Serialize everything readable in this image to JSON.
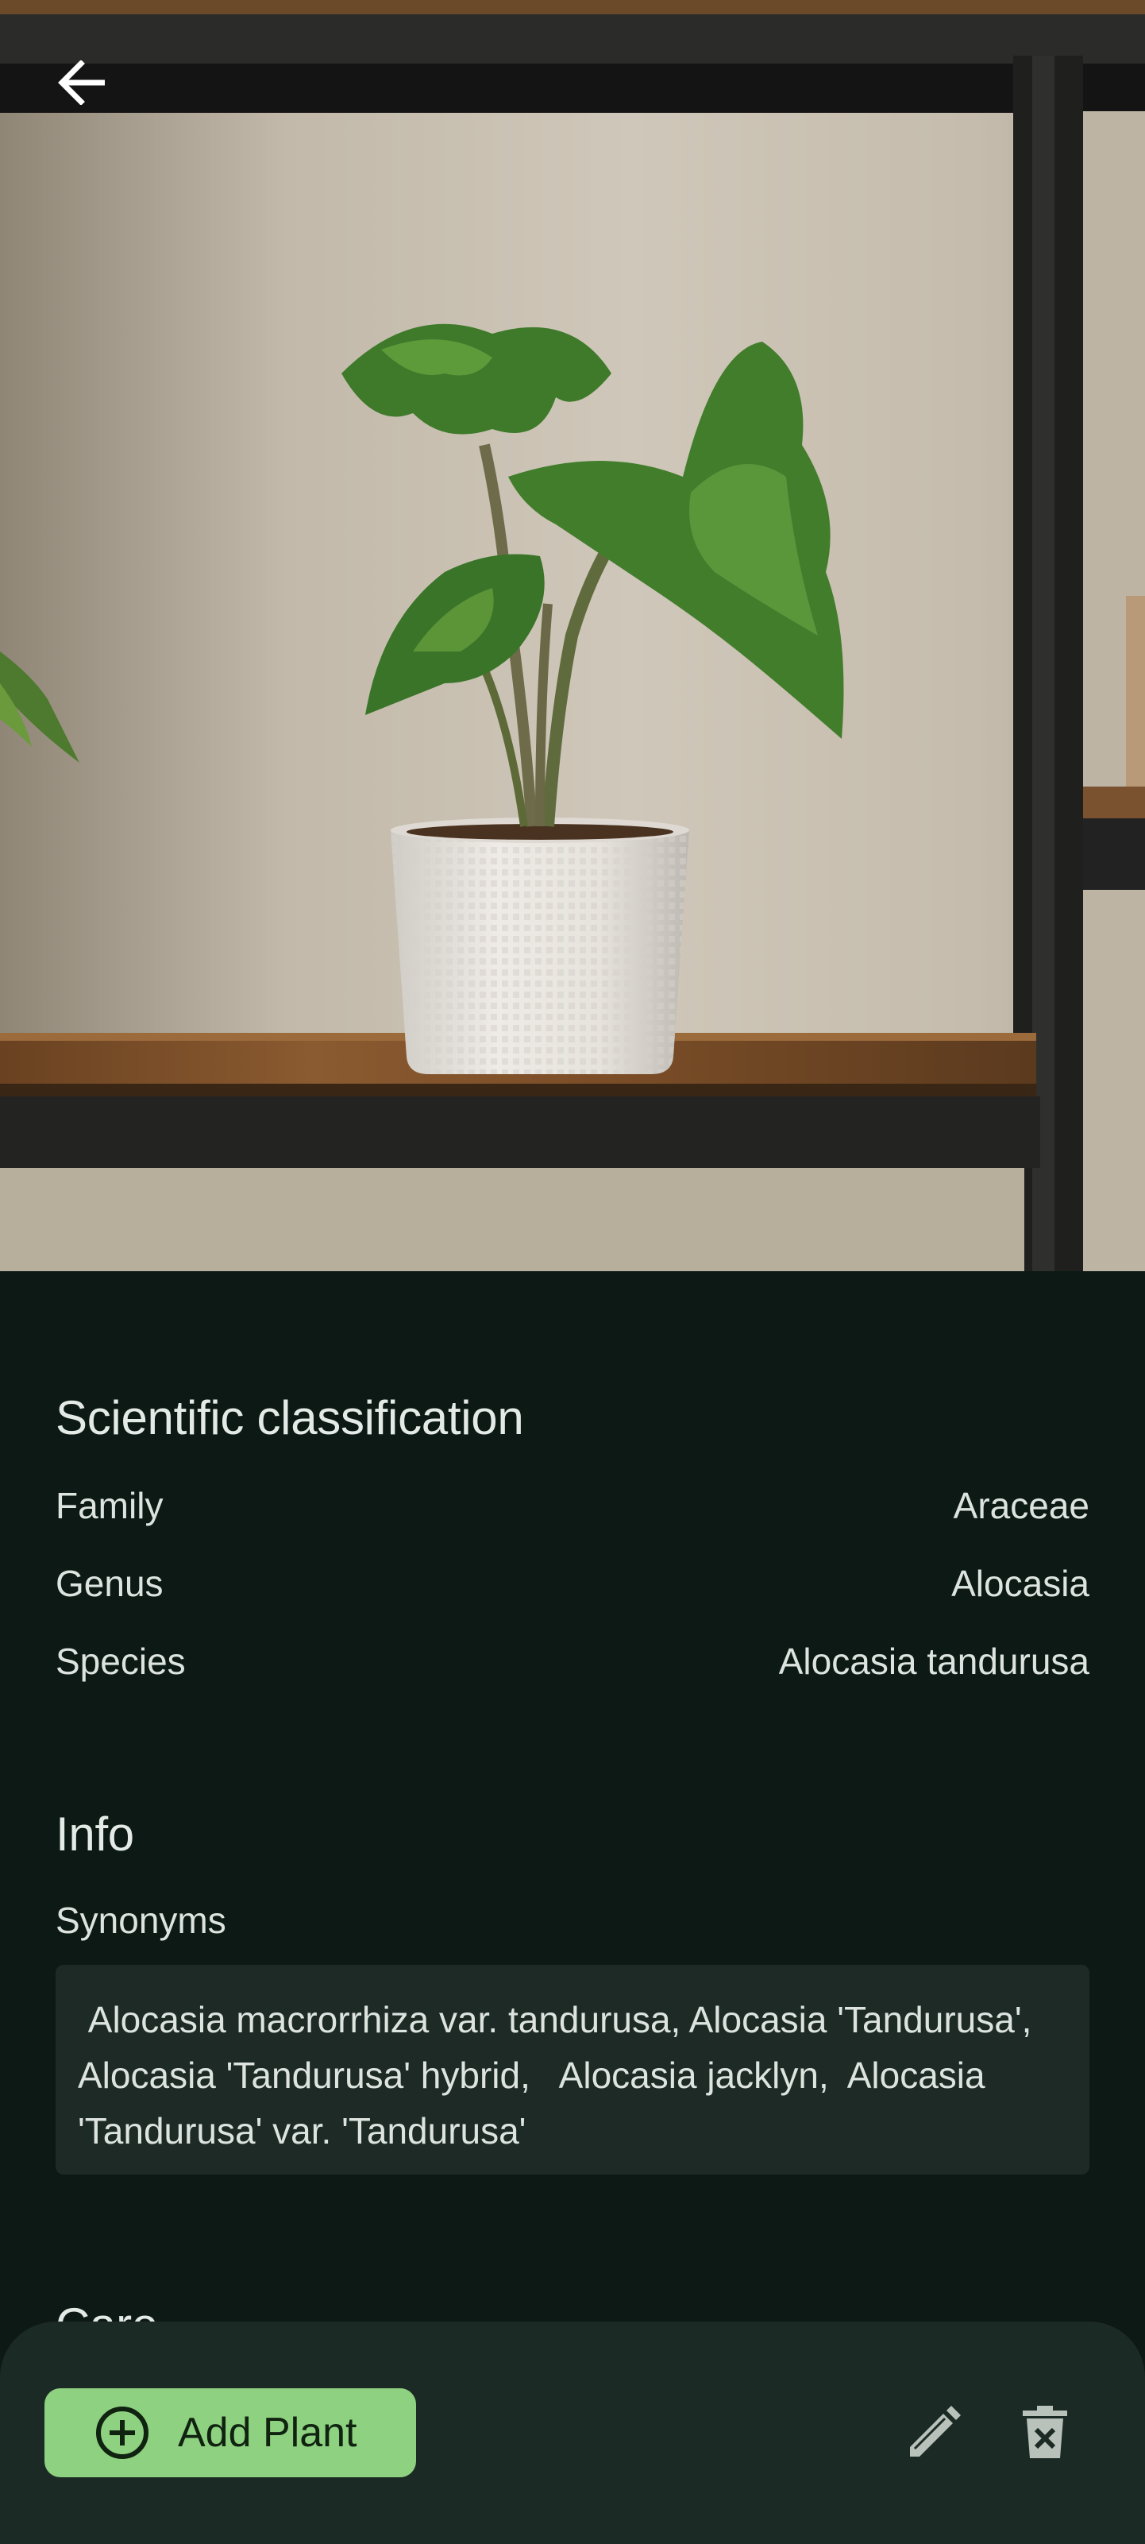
{
  "hero": {
    "image": "photo of a potted Alocasia plant on a wooden shelf",
    "back_icon": "arrow-left-icon"
  },
  "classification": {
    "title": "Scientific classification",
    "rows": [
      {
        "label": "Family",
        "value": "Araceae"
      },
      {
        "label": "Genus",
        "value": "Alocasia"
      },
      {
        "label": "Species",
        "value": "Alocasia tandurusa"
      }
    ]
  },
  "info": {
    "title": "Info",
    "synonyms_label": "Synonyms",
    "synonyms_text": " Alocasia macrorrhiza var. tandurusa, Alocasia 'Tandurusa',  Alocasia 'Tandurusa' hybrid,   Alocasia jacklyn,  Alocasia 'Tandurusa' var. 'Tandurusa'"
  },
  "care": {
    "title": "Care"
  },
  "bottom_bar": {
    "add_plant_label": "Add Plant",
    "add_icon": "add-circle-icon",
    "edit_icon": "pencil-icon",
    "delete_icon": "trash-icon"
  },
  "colors": {
    "background": "#0c1915",
    "surface": "#1c2a25",
    "accent": "#8ed180",
    "text": "#dde4df"
  }
}
